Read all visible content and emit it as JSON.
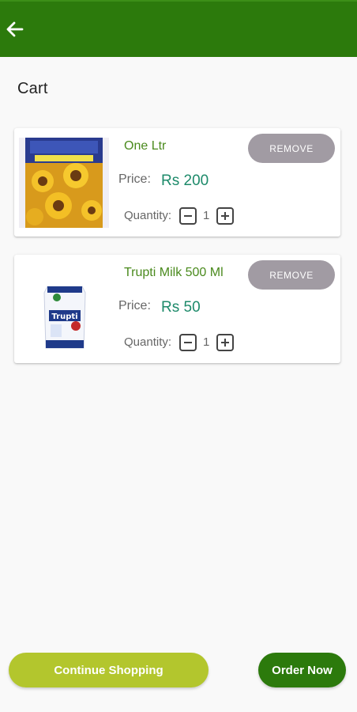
{
  "header": {
    "back_icon": "arrow-left-icon"
  },
  "page": {
    "title": "Cart"
  },
  "cart": {
    "items": [
      {
        "name": "One Ltr",
        "price_label": "Price:",
        "price": "Rs 200",
        "quantity_label": "Quantity:",
        "quantity": "1",
        "remove_label": "REMOVE",
        "image": "sunflower-oil-pouch"
      },
      {
        "name": "Trupti Milk 500 Ml",
        "price_label": "Price:",
        "price": "Rs 50",
        "quantity_label": "Quantity:",
        "quantity": "1",
        "remove_label": "REMOVE",
        "image": "trupti-milk-pouch",
        "image_text": "Trupti"
      }
    ]
  },
  "footer": {
    "continue_label": "Continue Shopping",
    "order_label": "Order Now"
  },
  "colors": {
    "appbar": "#2c7a0c",
    "product_name": "#4a8a1d",
    "price_value": "#1d8a6a",
    "remove_button": "#a19ba3",
    "continue_button": "#b3c62d",
    "order_button": "#2c7a0c"
  }
}
